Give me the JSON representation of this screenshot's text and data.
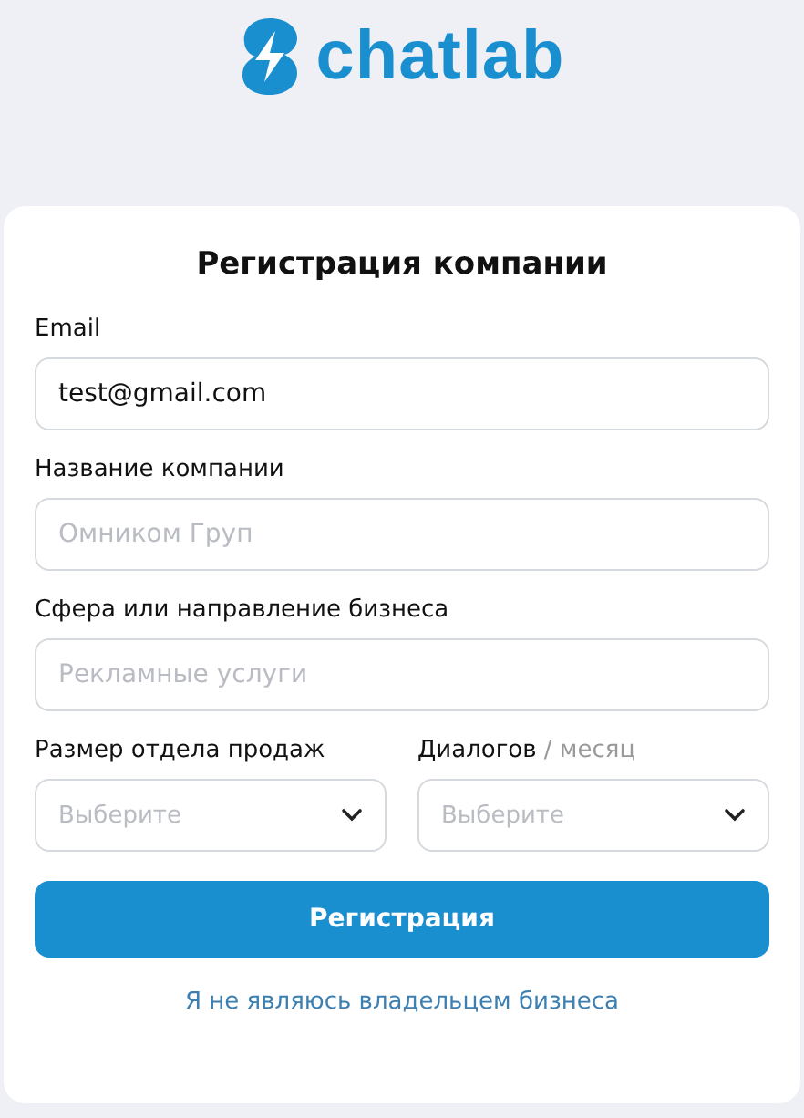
{
  "logo": {
    "text": "chatlab"
  },
  "form": {
    "title": "Регистрация компании",
    "fields": [
      {
        "kind": "text",
        "label": "Email",
        "value": "test@gmail.com"
      },
      {
        "kind": "text",
        "label": "Название компании",
        "placeholder": "Омником Груп"
      },
      {
        "kind": "text",
        "label": "Сфера или направление бизнеса",
        "placeholder": "Рекламные услуги"
      }
    ],
    "selects": [
      {
        "label": "Размер отдела продаж",
        "placeholder": "Выберите"
      },
      {
        "label": "Диалогов",
        "suffix": "/ месяц",
        "placeholder": "Выберите"
      }
    ],
    "submit": "Регистрация",
    "link": "Я не являюсь владельцем бизнеса"
  }
}
